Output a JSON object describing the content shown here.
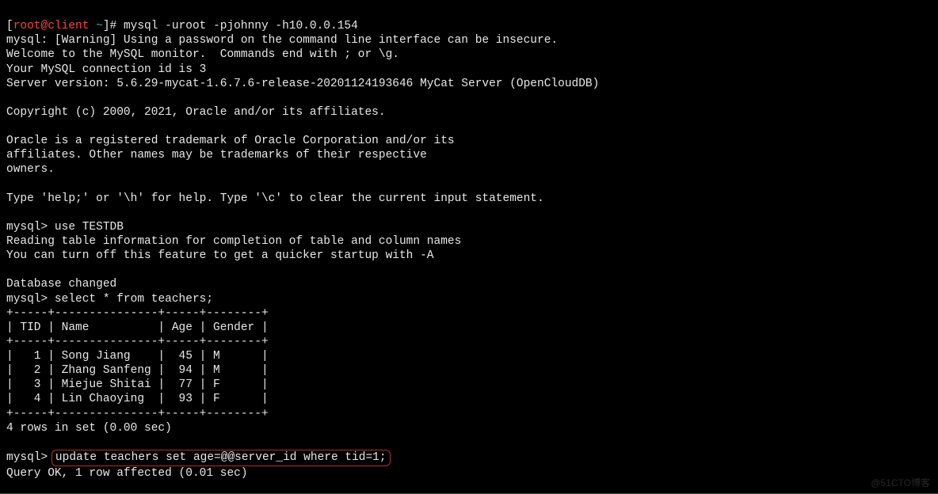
{
  "prompt": {
    "bracket_open": "[",
    "user": "root",
    "at": "@",
    "host": "client",
    "dir": " ~",
    "bracket_close": "]",
    "hash": "# ",
    "command": "mysql -uroot -pjohnny -h10.0.0.154"
  },
  "output": {
    "warn": "mysql: [Warning] Using a password on the command line interface can be insecure.",
    "welcome": "Welcome to the MySQL monitor.  Commands end with ; or \\g.",
    "connid": "Your MySQL connection id is 3",
    "version": "Server version: 5.6.29-mycat-1.6.7.6-release-20201124193646 MyCat Server (OpenCloudDB)",
    "blank1": "",
    "copyright": "Copyright (c) 2000, 2021, Oracle and/or its affiliates.",
    "blank2": "",
    "trademark1": "Oracle is a registered trademark of Oracle Corporation and/or its",
    "trademark2": "affiliates. Other names may be trademarks of their respective",
    "trademark3": "owners.",
    "blank3": "",
    "help": "Type 'help;' or '\\h' for help. Type '\\c' to clear the current input statement.",
    "blank4": ""
  },
  "sql1": {
    "prompt": "mysql> ",
    "cmd": "use TESTDB",
    "reading": "Reading table information for completion of table and column names",
    "turnoff": "You can turn off this feature to get a quicker startup with -A",
    "blank": "",
    "changed": "Database changed"
  },
  "sql2": {
    "prompt": "mysql> ",
    "cmd": "select * from teachers;"
  },
  "table": {
    "border": "+-----+---------------+-----+--------+",
    "header": "| TID | Name          | Age | Gender |",
    "rows": [
      "|   1 | Song Jiang    |  45 | M      |",
      "|   2 | Zhang Sanfeng |  94 | M      |",
      "|   3 | Miejue Shitai |  77 | F      |",
      "|   4 | Lin Chaoying  |  93 | F      |"
    ],
    "result": "4 rows in set (0.00 sec)"
  },
  "sql3": {
    "blank": "",
    "prompt": "mysql> ",
    "cmd": "update teachers set age=@@server_id where tid=1;",
    "result": "Query OK, 1 row affected (0.01 sec)"
  },
  "watermark": "@51CTO博客"
}
